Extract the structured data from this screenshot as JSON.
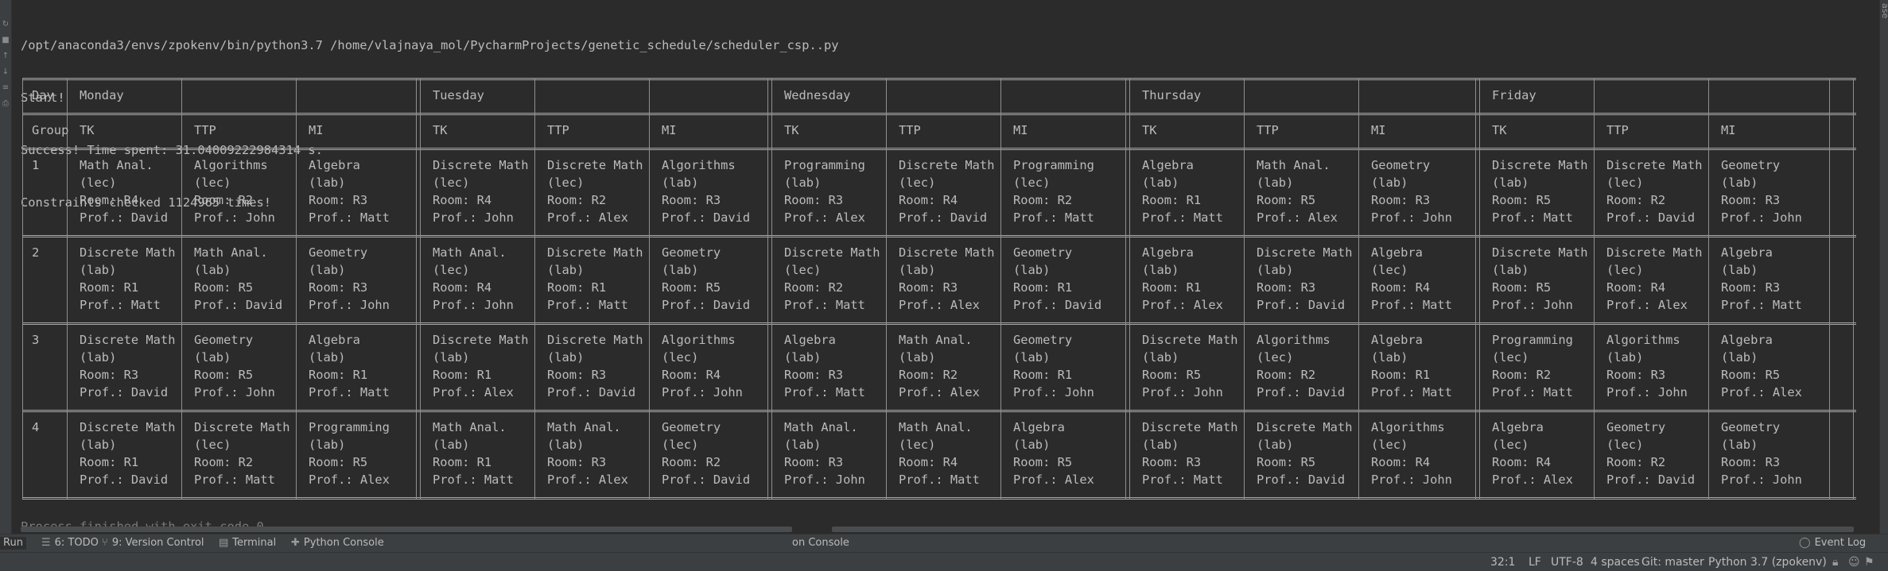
{
  "console": {
    "command": "/opt/anaconda3/envs/zpokenv/bin/python3.7 /home/vlajnaya_mol/PycharmProjects/genetic_schedule/scheduler_csp..py",
    "lines": [
      "Start!",
      "Success! Time spent: 31.04009222984314 s.",
      "Constraints checked 1124965 times!"
    ],
    "exit_message": "Process finished with exit code 0"
  },
  "table": {
    "day_label": "Day",
    "days": [
      "Monday",
      "Tuesday",
      "Wednesday",
      "Thursday",
      "Friday"
    ],
    "group_label": "Group",
    "groups": [
      "TK",
      "TTP",
      "MI"
    ],
    "rows": [
      {
        "num": "1",
        "cells": [
          [
            "Math Anal.",
            "(lec)",
            "Room: R4",
            "Prof.: David"
          ],
          [
            "Algorithms",
            "(lec)",
            "Room: R2",
            "Prof.: John"
          ],
          [
            "Algebra",
            "(lab)",
            "Room: R3",
            "Prof.: Matt"
          ],
          [
            "Discrete Math",
            "(lec)",
            "Room: R4",
            "Prof.: John"
          ],
          [
            "Discrete Math",
            "(lec)",
            "Room: R2",
            "Prof.: Alex"
          ],
          [
            "Algorithms",
            "(lab)",
            "Room: R3",
            "Prof.: David"
          ],
          [
            "Programming",
            "(lab)",
            "Room: R3",
            "Prof.: Alex"
          ],
          [
            "Discrete Math",
            "(lec)",
            "Room: R4",
            "Prof.: David"
          ],
          [
            "Programming",
            "(lec)",
            "Room: R2",
            "Prof.: Matt"
          ],
          [
            "Algebra",
            "(lab)",
            "Room: R1",
            "Prof.: Matt"
          ],
          [
            "Math Anal.",
            "(lab)",
            "Room: R5",
            "Prof.: Alex"
          ],
          [
            "Geometry",
            "(lab)",
            "Room: R3",
            "Prof.: John"
          ],
          [
            "Discrete Math",
            "(lab)",
            "Room: R5",
            "Prof.: Matt"
          ],
          [
            "Discrete Math",
            "(lec)",
            "Room: R2",
            "Prof.: David"
          ],
          [
            "Geometry",
            "(lab)",
            "Room: R3",
            "Prof.: John"
          ]
        ]
      },
      {
        "num": "2",
        "cells": [
          [
            "Discrete Math",
            "(lab)",
            "Room: R1",
            "Prof.: Matt"
          ],
          [
            "Math Anal.",
            "(lab)",
            "Room: R5",
            "Prof.: David"
          ],
          [
            "Geometry",
            "(lab)",
            "Room: R3",
            "Prof.: John"
          ],
          [
            "Math Anal.",
            "(lec)",
            "Room: R4",
            "Prof.: John"
          ],
          [
            "Discrete Math",
            "(lab)",
            "Room: R1",
            "Prof.: Matt"
          ],
          [
            "Geometry",
            "(lab)",
            "Room: R5",
            "Prof.: David"
          ],
          [
            "Discrete Math",
            "(lec)",
            "Room: R2",
            "Prof.: Matt"
          ],
          [
            "Discrete Math",
            "(lab)",
            "Room: R3",
            "Prof.: Alex"
          ],
          [
            "Geometry",
            "(lab)",
            "Room: R1",
            "Prof.: David"
          ],
          [
            "Algebra",
            "(lab)",
            "Room: R1",
            "Prof.: Alex"
          ],
          [
            "Discrete Math",
            "(lab)",
            "Room: R3",
            "Prof.: David"
          ],
          [
            "Algebra",
            "(lec)",
            "Room: R4",
            "Prof.: Matt"
          ],
          [
            "Discrete Math",
            "(lab)",
            "Room: R5",
            "Prof.: John"
          ],
          [
            "Discrete Math",
            "(lec)",
            "Room: R4",
            "Prof.: Alex"
          ],
          [
            "Algebra",
            "(lab)",
            "Room: R3",
            "Prof.: Matt"
          ]
        ]
      },
      {
        "num": "3",
        "cells": [
          [
            "Discrete Math",
            "(lab)",
            "Room: R3",
            "Prof.: David"
          ],
          [
            "Geometry",
            "(lab)",
            "Room: R5",
            "Prof.: John"
          ],
          [
            "Algebra",
            "(lab)",
            "Room: R1",
            "Prof.: Matt"
          ],
          [
            "Discrete Math",
            "(lab)",
            "Room: R1",
            "Prof.: Alex"
          ],
          [
            "Discrete Math",
            "(lab)",
            "Room: R3",
            "Prof.: David"
          ],
          [
            "Algorithms",
            "(lec)",
            "Room: R4",
            "Prof.: John"
          ],
          [
            "Algebra",
            "(lab)",
            "Room: R3",
            "Prof.: Matt"
          ],
          [
            "Math Anal.",
            "(lab)",
            "Room: R2",
            "Prof.: Alex"
          ],
          [
            "Geometry",
            "(lab)",
            "Room: R1",
            "Prof.: John"
          ],
          [
            "Discrete Math",
            "(lab)",
            "Room: R5",
            "Prof.: John"
          ],
          [
            "Algorithms",
            "(lec)",
            "Room: R2",
            "Prof.: David"
          ],
          [
            "Algebra",
            "(lab)",
            "Room: R1",
            "Prof.: Matt"
          ],
          [
            "Programming",
            "(lec)",
            "Room: R2",
            "Prof.: Matt"
          ],
          [
            "Algorithms",
            "(lab)",
            "Room: R3",
            "Prof.: John"
          ],
          [
            "Algebra",
            "(lab)",
            "Room: R5",
            "Prof.: Alex"
          ]
        ]
      },
      {
        "num": "4",
        "cells": [
          [
            "Discrete Math",
            "(lab)",
            "Room: R1",
            "Prof.: David"
          ],
          [
            "Discrete Math",
            "(lec)",
            "Room: R2",
            "Prof.: Matt"
          ],
          [
            "Programming",
            "(lab)",
            "Room: R5",
            "Prof.: Alex"
          ],
          [
            "Math Anal.",
            "(lab)",
            "Room: R1",
            "Prof.: Matt"
          ],
          [
            "Math Anal.",
            "(lab)",
            "Room: R3",
            "Prof.: Alex"
          ],
          [
            "Geometry",
            "(lec)",
            "Room: R2",
            "Prof.: David"
          ],
          [
            "Math Anal.",
            "(lab)",
            "Room: R3",
            "Prof.: John"
          ],
          [
            "Math Anal.",
            "(lec)",
            "Room: R4",
            "Prof.: Matt"
          ],
          [
            "Algebra",
            "(lab)",
            "Room: R5",
            "Prof.: Alex"
          ],
          [
            "Discrete Math",
            "(lab)",
            "Room: R3",
            "Prof.: Matt"
          ],
          [
            "Discrete Math",
            "(lab)",
            "Room: R5",
            "Prof.: David"
          ],
          [
            "Algorithms",
            "(lec)",
            "Room: R4",
            "Prof.: John"
          ],
          [
            "Algebra",
            "(lec)",
            "Room: R4",
            "Prof.: Alex"
          ],
          [
            "Geometry",
            "(lec)",
            "Room: R2",
            "Prof.: David"
          ],
          [
            "Geometry",
            "(lab)",
            "Room: R3",
            "Prof.: John"
          ]
        ]
      }
    ]
  },
  "tool_windows": {
    "run": "Run",
    "todo": "6: TODO",
    "vcs": "9: Version Control",
    "terminal": "Terminal",
    "python_console": "Python Console",
    "run_console_tab": "on Console",
    "event_log": "Event Log"
  },
  "statusbar": {
    "position": "32:1",
    "line_sep": "LF",
    "encoding": "UTF-8",
    "indent": "4 spaces",
    "git": "Git: master",
    "interpreter": "Python 3.7 (zpokenv)"
  },
  "right_strip_label": "ase",
  "colors": {
    "bg": "#2b2b2b",
    "text": "#bbbbbb",
    "panel": "#3c3f41"
  }
}
